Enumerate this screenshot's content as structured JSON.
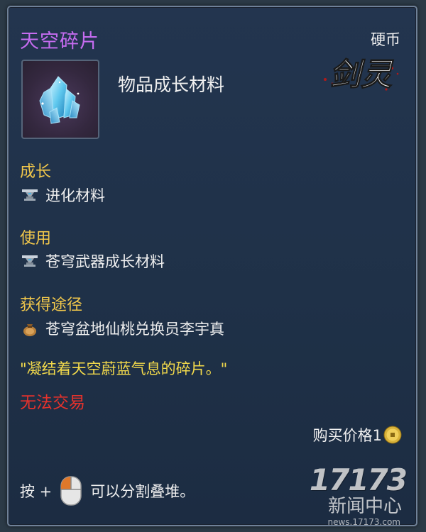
{
  "item": {
    "name": "天空碎片",
    "category": "物品成长材料",
    "currency_label": "硬币",
    "name_color": "#c56cf0"
  },
  "logo": {
    "text": "剑灵"
  },
  "sections": {
    "growth": {
      "heading": "成长",
      "value": "进化材料",
      "icon": "anvil-icon"
    },
    "usage": {
      "heading": "使用",
      "value": "苍穹武器成长材料",
      "icon": "anvil-icon"
    },
    "source": {
      "heading": "获得途径",
      "value": "苍穹盆地仙桃兑换员李宇真",
      "icon": "pouch-icon"
    }
  },
  "flavor_text": "\"凝结着天空蔚蓝气息的碎片。\"",
  "trade_status": "无法交易",
  "price": {
    "label": "购买价格1",
    "icon": "coin-icon"
  },
  "split_hint": {
    "prefix": "按 +",
    "suffix": "可以分割叠堆。",
    "icon": "mouse-icon"
  },
  "watermark": {
    "logo": "17173",
    "subtitle": "新闻中心",
    "url": "news.17173.com"
  },
  "colors": {
    "heading": "#f2c84b",
    "flavor": "#f2d94b",
    "warning": "#e5322c"
  }
}
